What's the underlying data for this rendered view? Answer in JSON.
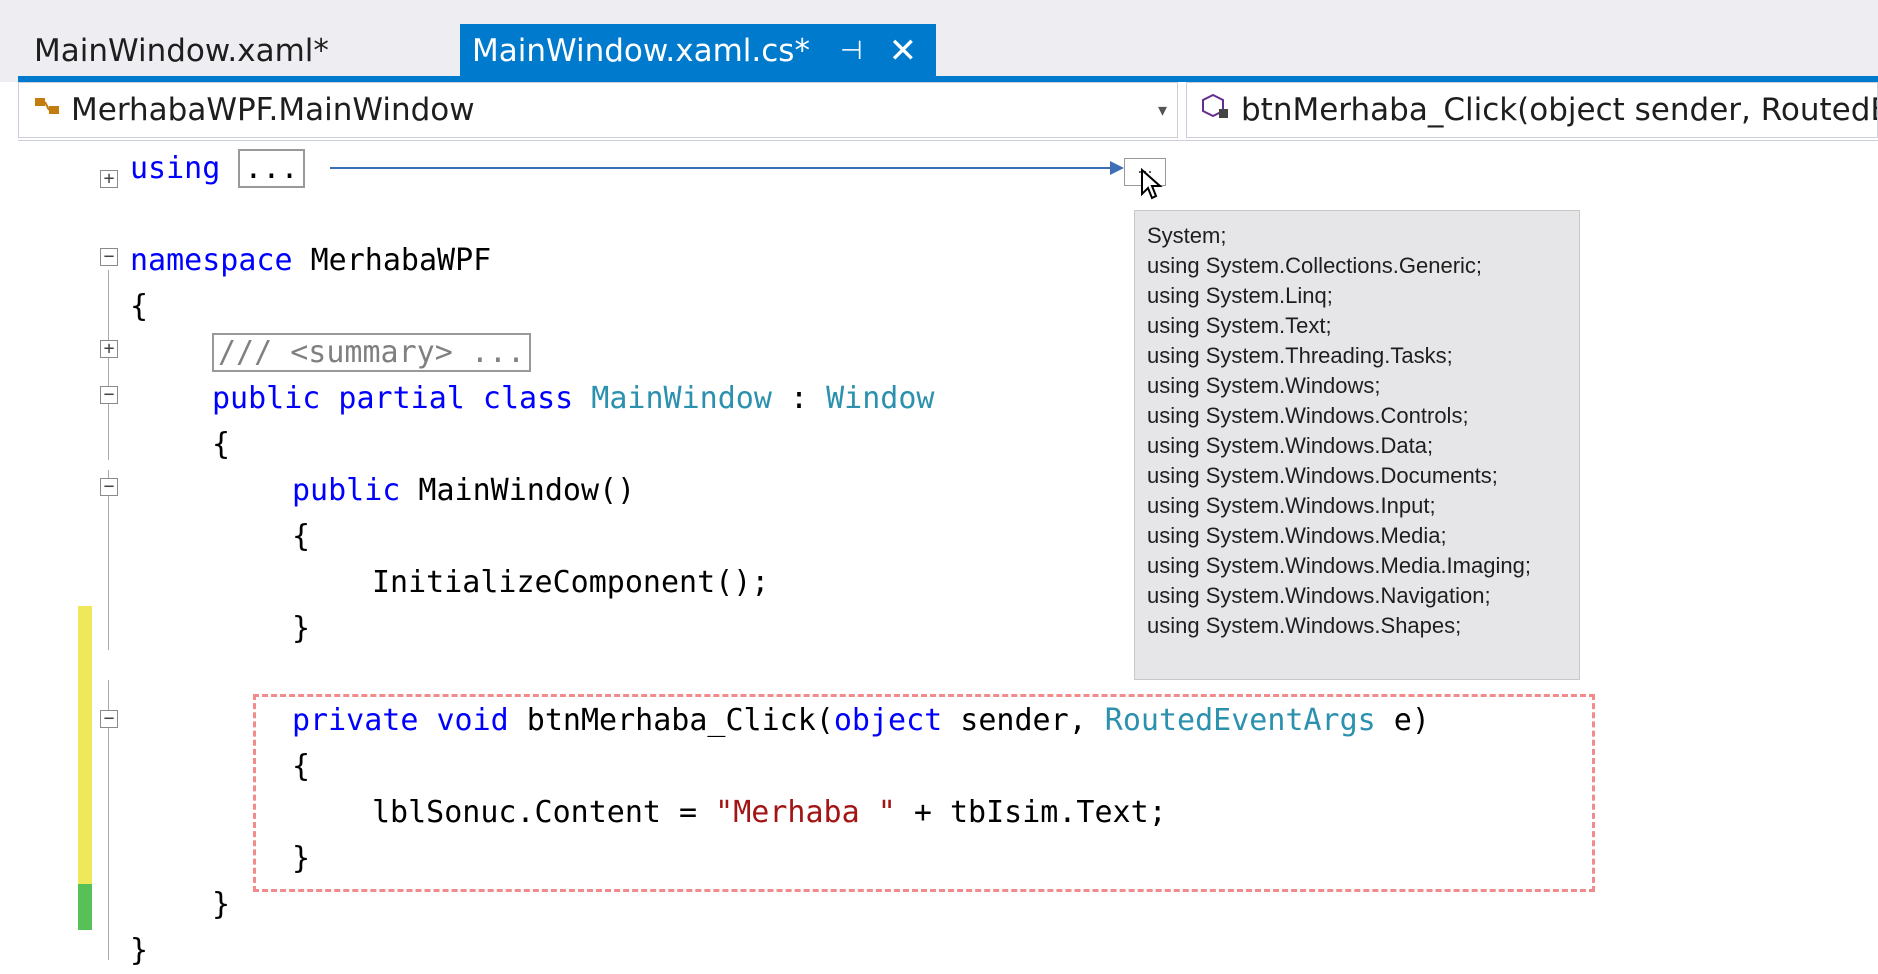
{
  "tabs": [
    {
      "label": "MainWindow.xaml*",
      "active": false
    },
    {
      "label": "MainWindow.xaml.cs*",
      "active": true,
      "pin": "⊣",
      "close": "✕"
    }
  ],
  "nav": {
    "left_label": "MerhabaWPF.MainWindow",
    "left_icon": "class-icon",
    "right_label": "btnMerhaba_Click(object sender, RoutedE",
    "right_icon": "method-icon"
  },
  "code": {
    "l1_kw": "using",
    "l1_box": "...",
    "l2_kw": "namespace",
    "l2_name": " MerhabaWPF",
    "l3": "{",
    "l4": "/// <summary> ...",
    "l5_kw": "public partial class",
    "l5_t1": "MainWindow",
    "l5_sep": " : ",
    "l5_t2": "Window",
    "l6": "{",
    "l7_kw": "public",
    "l7_rest": " MainWindow()",
    "l8": "{",
    "l9": "InitializeComponent();",
    "l10": "}",
    "l11_kw": "private void",
    "l11_mid": " btnMerhaba_Click(",
    "l11_kw2": "object",
    "l11_mid2": " sender, ",
    "l11_t": "RoutedEventArgs",
    "l11_end": " e)",
    "l12": "{",
    "l13_a": "lblSonuc.Content = ",
    "l13_str": "\"Merhaba \"",
    "l13_b": " + tbIsim.Text;",
    "l14": "}",
    "l15": "}",
    "l16": "}"
  },
  "tooltip": {
    "items": [
      "System;",
      "using System.Collections.Generic;",
      "using System.Linq;",
      "using System.Text;",
      "using System.Threading.Tasks;",
      "using System.Windows;",
      "using System.Windows.Controls;",
      "using System.Windows.Data;",
      "using System.Windows.Documents;",
      "using System.Windows.Input;",
      "using System.Windows.Media;",
      "using System.Windows.Media.Imaging;",
      "using System.Windows.Navigation;",
      "using System.Windows.Shapes;"
    ]
  },
  "colors": {
    "accent": "#007acc",
    "keyword": "#0000ff",
    "type": "#2b91af",
    "string": "#a31515",
    "highlight": "#f28b8b"
  }
}
